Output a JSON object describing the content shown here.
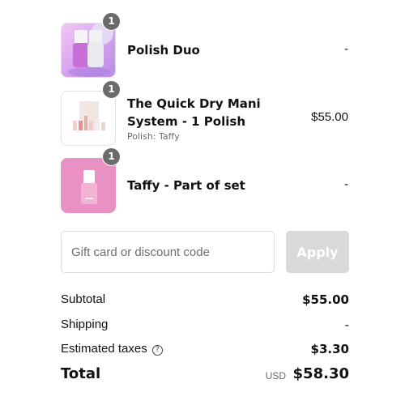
{
  "line_items": [
    {
      "quantity": "1",
      "title": "Polish Duo",
      "variant": "",
      "price": "-"
    },
    {
      "quantity": "1",
      "title": "The Quick Dry Mani System - 1 Polish",
      "variant": "Polish: Taffy",
      "price": "$55.00"
    },
    {
      "quantity": "1",
      "title": "Taffy - Part of set",
      "variant": "",
      "price": "-"
    }
  ],
  "discount": {
    "placeholder": "Gift card or discount code",
    "value": "",
    "apply_label": "Apply"
  },
  "summary": {
    "subtotal_label": "Subtotal",
    "subtotal_value": "$55.00",
    "shipping_label": "Shipping",
    "shipping_value": "-",
    "taxes_label": "Estimated taxes",
    "taxes_icon": "question-circle-icon",
    "taxes_value": "$3.30",
    "total_label": "Total",
    "currency": "USD",
    "total_value": "$58.30"
  },
  "colors": {
    "badge": "#6b6b6b",
    "apply_disabled": "#d9d9d9",
    "taffy_pink": "#e991c4"
  }
}
